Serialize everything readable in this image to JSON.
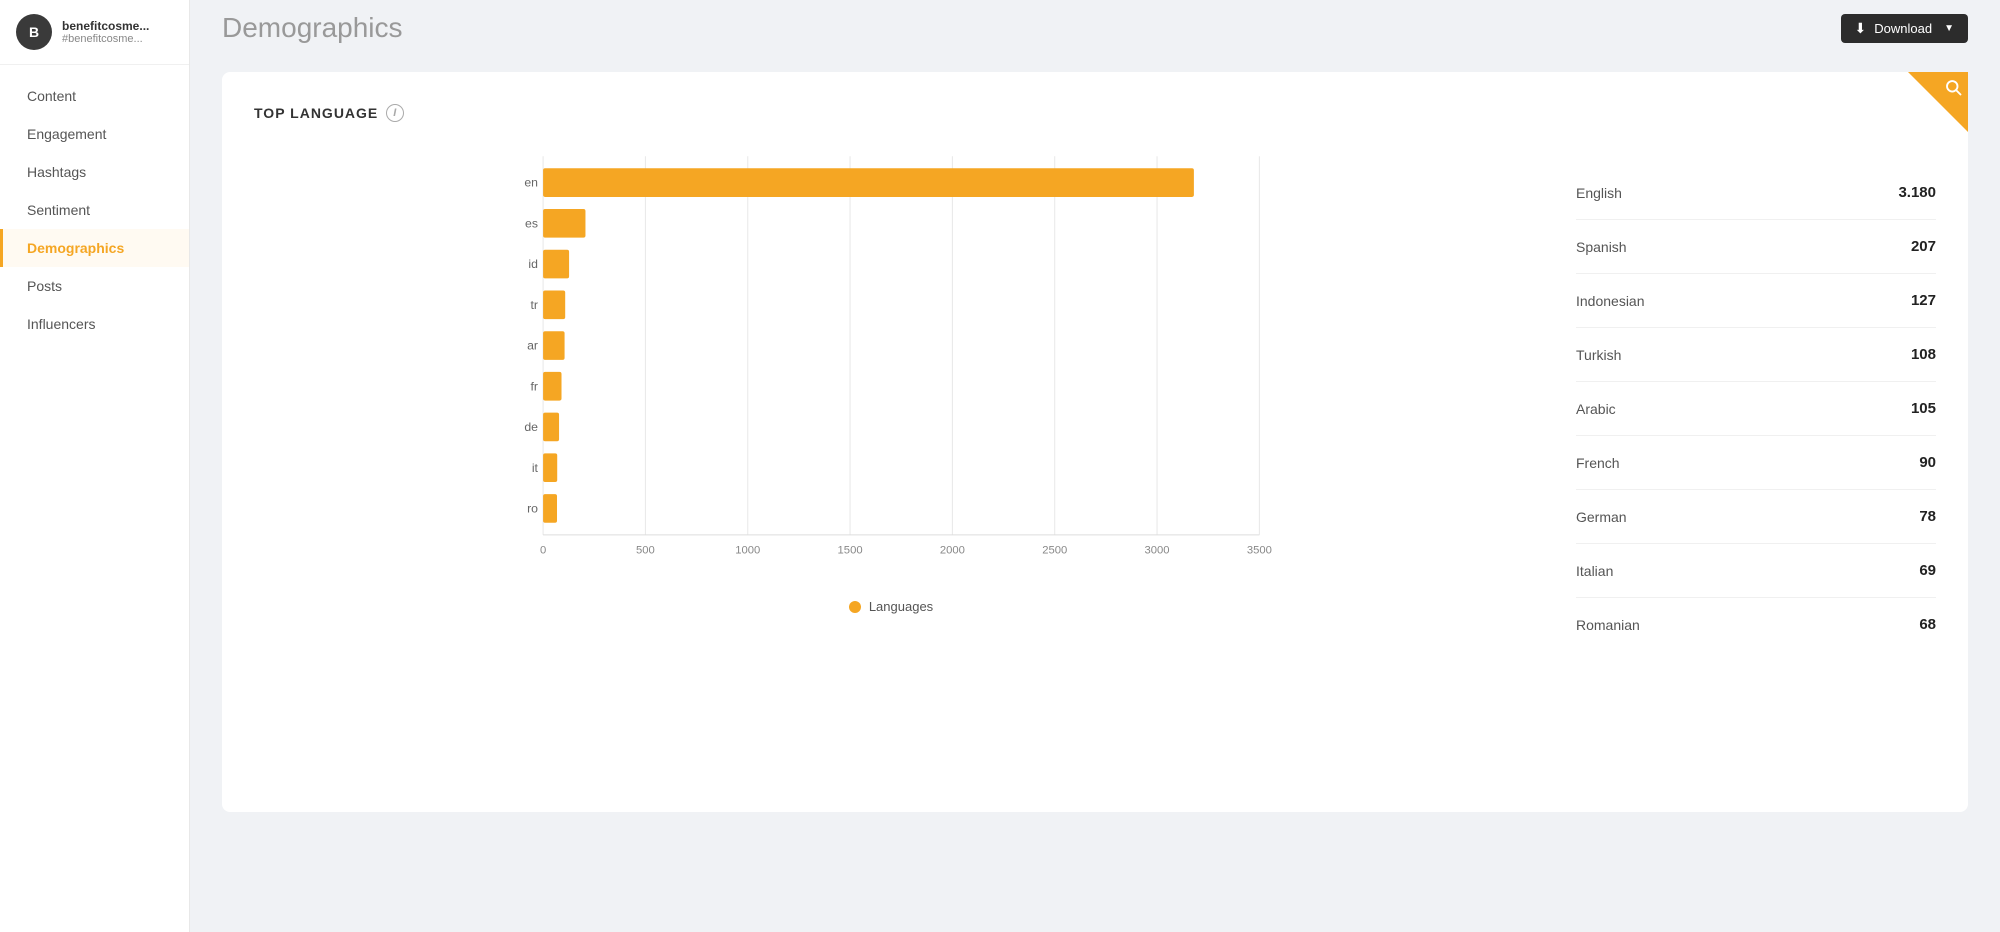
{
  "sidebar": {
    "avatar_letter": "B",
    "account_name": "benefitcosme...",
    "account_handle": "#benefitcosme...",
    "nav_items": [
      {
        "id": "content",
        "label": "Content",
        "active": false
      },
      {
        "id": "engagement",
        "label": "Engagement",
        "active": false
      },
      {
        "id": "hashtags",
        "label": "Hashtags",
        "active": false
      },
      {
        "id": "sentiment",
        "label": "Sentiment",
        "active": false
      },
      {
        "id": "demographics",
        "label": "Demographics",
        "active": true
      },
      {
        "id": "posts",
        "label": "Posts",
        "active": false
      },
      {
        "id": "influencers",
        "label": "Influencers",
        "active": false
      }
    ]
  },
  "topbar": {
    "page_title": "Demographics",
    "download_label": "Download"
  },
  "card": {
    "section_title": "TOP LANGUAGE",
    "legend_label": "Languages"
  },
  "chart": {
    "bars": [
      {
        "code": "en",
        "value": 3180,
        "max": 3500
      },
      {
        "code": "es",
        "value": 207,
        "max": 3500
      },
      {
        "code": "id",
        "value": 127,
        "max": 3500
      },
      {
        "code": "tr",
        "value": 108,
        "max": 3500
      },
      {
        "code": "ar",
        "value": 105,
        "max": 3500
      },
      {
        "code": "fr",
        "value": 90,
        "max": 3500
      },
      {
        "code": "de",
        "value": 78,
        "max": 3500
      },
      {
        "code": "it",
        "value": 69,
        "max": 3500
      },
      {
        "code": "ro",
        "value": 68,
        "max": 3500
      }
    ],
    "x_ticks": [
      "0",
      "500",
      "1000",
      "1500",
      "2000",
      "2500",
      "3000",
      "3500"
    ]
  },
  "stats": [
    {
      "label": "English",
      "value": "3.180"
    },
    {
      "label": "Spanish",
      "value": "207"
    },
    {
      "label": "Indonesian",
      "value": "127"
    },
    {
      "label": "Turkish",
      "value": "108"
    },
    {
      "label": "Arabic",
      "value": "105"
    },
    {
      "label": "French",
      "value": "90"
    },
    {
      "label": "German",
      "value": "78"
    },
    {
      "label": "Italian",
      "value": "69"
    },
    {
      "label": "Romanian",
      "value": "68"
    }
  ]
}
